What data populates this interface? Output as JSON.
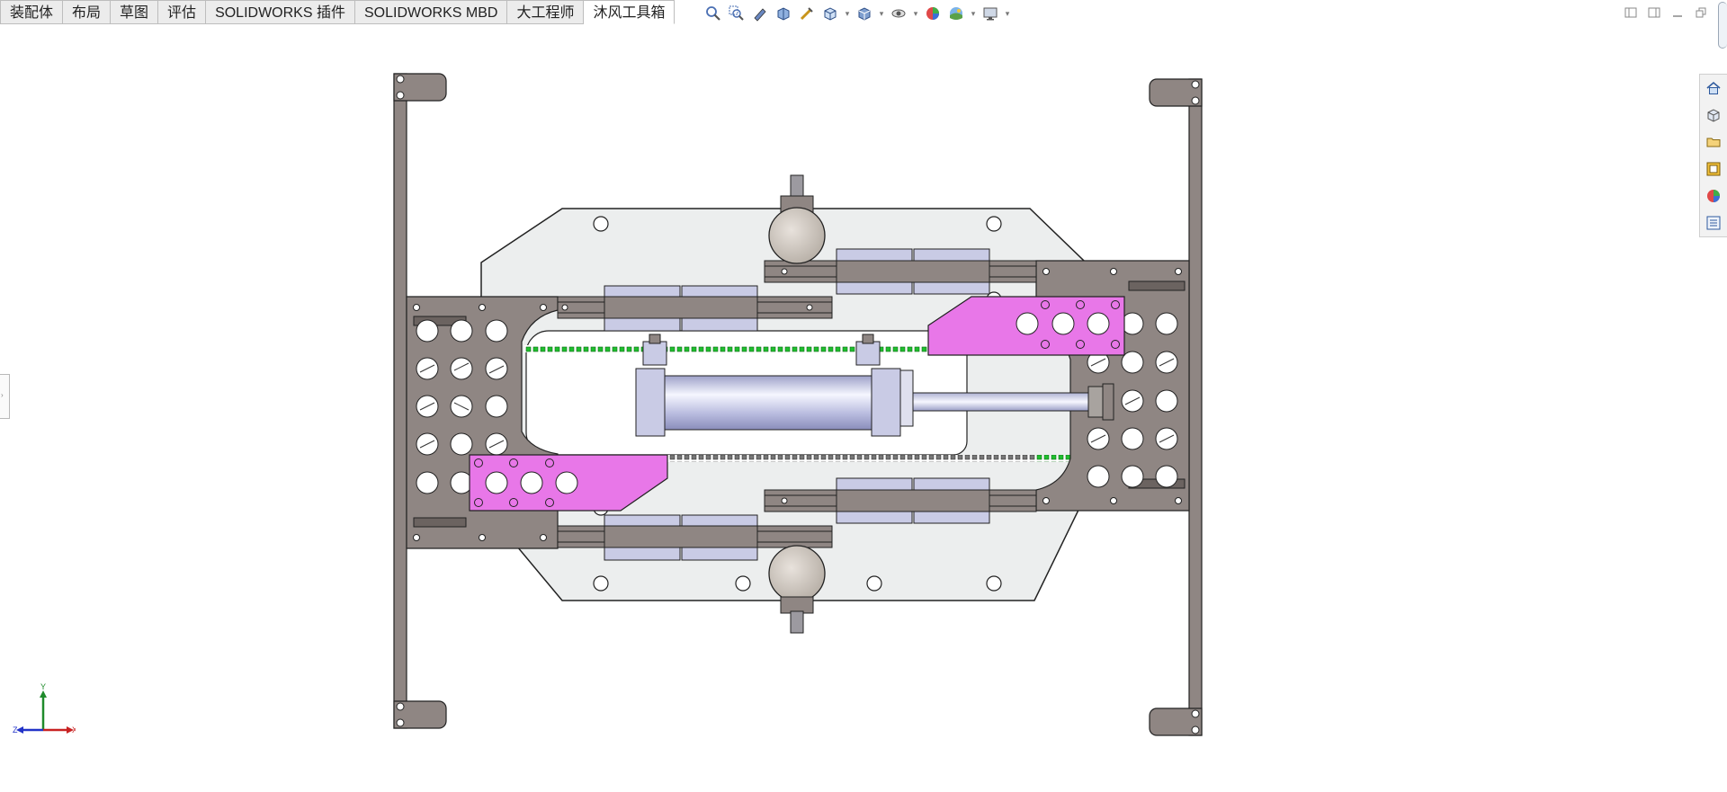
{
  "command_tabs": [
    "装配体",
    "布局",
    "草图",
    "评估",
    "SOLIDWORKS 插件",
    "SOLIDWORKS MBD",
    "大工程师",
    "沐风工具箱"
  ],
  "active_tab_index": 7,
  "heads_up_toolbar": [
    "zoom-to-fit-icon",
    "zoom-to-area-icon",
    "previous-view-icon",
    "section-view-icon",
    "dynamic-annotation-icon",
    "view-orientation-icon",
    "display-style-icon",
    "hide-show-items-icon",
    "edit-appearance-icon",
    "apply-scene-icon",
    "view-settings-icon"
  ],
  "window_controls": [
    "tile-left-icon",
    "tile-right-icon",
    "minimize-icon",
    "restore-icon"
  ],
  "task_pane": [
    "home-icon",
    "parts-library-icon",
    "file-explorer-icon",
    "view-palette-icon",
    "appearances-icon",
    "custom-properties-icon"
  ],
  "triad": {
    "x_label": "X",
    "y_label": "Y",
    "z_label": "Z"
  },
  "colors": {
    "plate": "#8f8683",
    "base": "#eceeee",
    "bracket": "#e877e8",
    "cylinder": "#c9cbe5",
    "rail": "#8f8683",
    "belt": "#1fbf2e"
  }
}
